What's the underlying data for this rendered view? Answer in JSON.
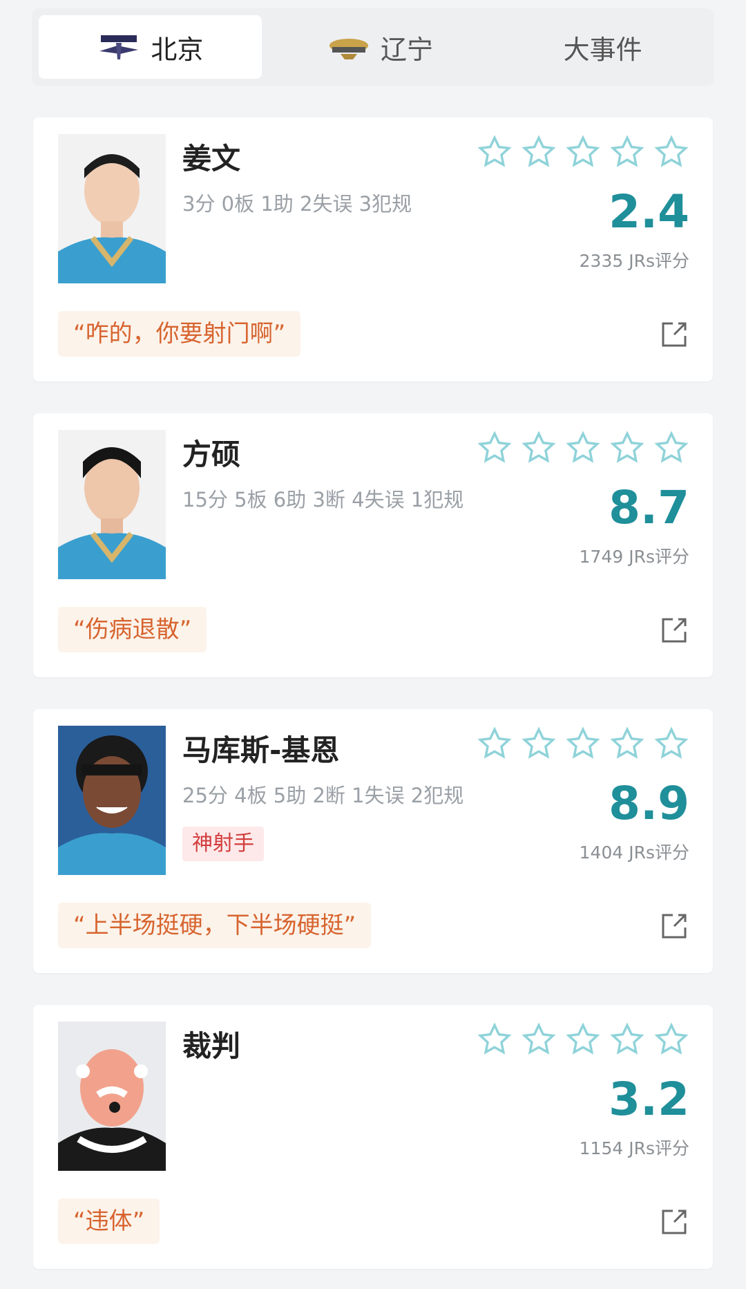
{
  "tabs": [
    {
      "label": "北京",
      "active": true,
      "logo": "beijing-ducks-logo"
    },
    {
      "label": "辽宁",
      "active": false,
      "logo": "liaoning-leopards-logo"
    },
    {
      "label": "大事件",
      "active": false
    }
  ],
  "colors": {
    "accent": "#1f8f9a",
    "star_outline": "#8fd3d9",
    "comment_text": "#d7642f",
    "tag_text": "#d23b3b"
  },
  "cards": [
    {
      "name": "姜文",
      "stats": "3分 0板 1助 2失误 3犯规",
      "tag": "",
      "score": "2.4",
      "votes": "2335 JRs评分",
      "comment": "“咋的，你要射门啊”",
      "stars_filled": 0,
      "stars_total": 5
    },
    {
      "name": "方硕",
      "stats": "15分 5板 6助 3断 4失误 1犯规",
      "tag": "",
      "score": "8.7",
      "votes": "1749 JRs评分",
      "comment": "“伤病退散”",
      "stars_filled": 0,
      "stars_total": 5
    },
    {
      "name": "马库斯-基恩",
      "stats": "25分 4板 5助 2断 1失误 2犯规",
      "tag": "神射手",
      "score": "8.9",
      "votes": "1404 JRs评分",
      "comment": "“上半场挺硬，下半场硬挺”",
      "stars_filled": 0,
      "stars_total": 5
    },
    {
      "name": "裁判",
      "stats": "",
      "tag": "",
      "score": "3.2",
      "votes": "1154 JRs评分",
      "comment": "“违体”",
      "stars_filled": 0,
      "stars_total": 5
    }
  ]
}
